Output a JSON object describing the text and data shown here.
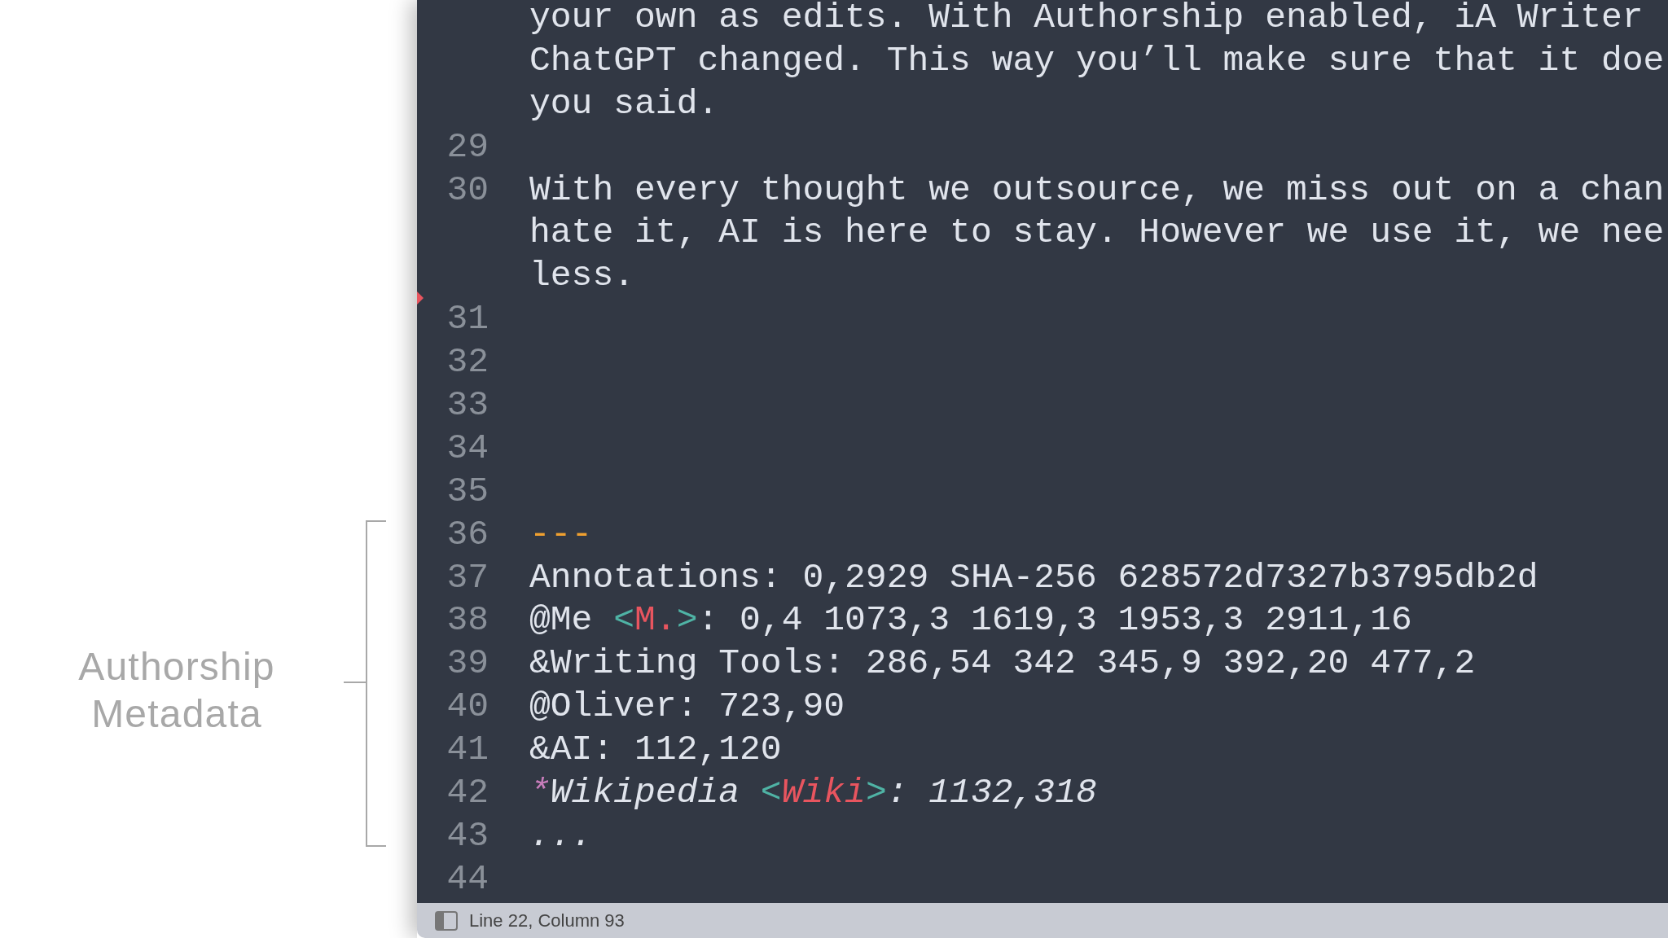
{
  "annotation": {
    "label_lines": [
      "Authorship",
      "Metadata"
    ]
  },
  "editor": {
    "lines": [
      {
        "segments": [
          {
            "kind": "plain",
            "text": "your own as edits. With Authorship enabled, iA Writer"
          }
        ]
      },
      {
        "segments": [
          {
            "kind": "plain",
            "text": "ChatGPT changed. This way you’ll make sure that it doe"
          }
        ]
      },
      {
        "segments": [
          {
            "kind": "plain",
            "text": "you said."
          }
        ]
      },
      {
        "number": "29"
      },
      {
        "number": "30",
        "segments": [
          {
            "kind": "plain",
            "text": "With every thought we outsource, we miss out on a chan"
          }
        ]
      },
      {
        "segments": [
          {
            "kind": "plain",
            "text": "hate it, AI is here to stay. However we use it, we nee"
          }
        ]
      },
      {
        "segments": [
          {
            "kind": "plain",
            "text": "less."
          }
        ]
      },
      {
        "number": "31"
      },
      {
        "number": "32"
      },
      {
        "number": "33"
      },
      {
        "number": "34"
      },
      {
        "number": "35"
      },
      {
        "number": "36",
        "segments": [
          {
            "kind": "rule",
            "text": "---"
          }
        ]
      },
      {
        "number": "37",
        "segments": [
          {
            "kind": "plain",
            "text": "Annotations: 0,2929 SHA-256 628572d7327b3795db2d"
          }
        ]
      },
      {
        "number": "38",
        "segments": [
          {
            "kind": "plain",
            "text": "@Me "
          },
          {
            "kind": "bracket",
            "text": "<"
          },
          {
            "kind": "tag",
            "text": "M."
          },
          {
            "kind": "bracket",
            "text": ">"
          },
          {
            "kind": "plain",
            "text": ": 0,4 1073,3 1619,3 1953,3 2911,16"
          }
        ]
      },
      {
        "number": "39",
        "segments": [
          {
            "kind": "plain",
            "text": "&Writing Tools: 286,54 342 345,9 392,20 477,2"
          }
        ]
      },
      {
        "number": "40",
        "segments": [
          {
            "kind": "plain",
            "text": "@Oliver: 723,90"
          }
        ]
      },
      {
        "number": "41",
        "segments": [
          {
            "kind": "plain",
            "text": "&AI: 112,120"
          }
        ]
      },
      {
        "number": "42",
        "italic": true,
        "segments": [
          {
            "kind": "star",
            "text": "*"
          },
          {
            "kind": "plain",
            "text": "Wikipedia "
          },
          {
            "kind": "bracket",
            "text": "<"
          },
          {
            "kind": "tag",
            "text": "Wiki"
          },
          {
            "kind": "bracket",
            "text": ">"
          },
          {
            "kind": "plain",
            "text": ": 1132,318"
          }
        ]
      },
      {
        "number": "43",
        "italic": true,
        "segments": [
          {
            "kind": "plain",
            "text": "..."
          }
        ]
      },
      {
        "number": "44"
      }
    ]
  },
  "status_bar": {
    "position": "Line 22, Column 93"
  }
}
